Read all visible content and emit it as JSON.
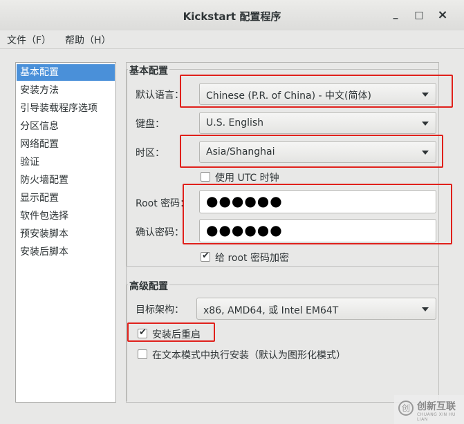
{
  "window": {
    "title": "Kickstart 配置程序",
    "minimize": "_",
    "maximize": "□",
    "close": "×"
  },
  "menu": {
    "file": "文件（F）",
    "help": "帮助（H）"
  },
  "sidebar": {
    "items": [
      {
        "label": "基本配置"
      },
      {
        "label": "安装方法"
      },
      {
        "label": "引导装载程序选项"
      },
      {
        "label": "分区信息"
      },
      {
        "label": "网络配置"
      },
      {
        "label": "验证"
      },
      {
        "label": "防火墙配置"
      },
      {
        "label": "显示配置"
      },
      {
        "label": "软件包选择"
      },
      {
        "label": "预安装脚本"
      },
      {
        "label": "安装后脚本"
      }
    ],
    "selected": "基本配置"
  },
  "basic": {
    "heading": "基本配置",
    "language_label": "默认语言：",
    "language_value": "Chinese (P.R. of China) - 中文(简体)",
    "keyboard_label": "键盘：",
    "keyboard_value": "U.S. English",
    "timezone_label": "时区：",
    "timezone_value": "Asia/Shanghai",
    "utc_label": "使用  UTC 时钟",
    "utc_checked": false,
    "root_pw_label": "Root 密码：",
    "root_pw_value": "●●●●●●",
    "confirm_pw_label": "确认密码：",
    "confirm_pw_value": "●●●●●●",
    "encrypt_label": "给  root 密码加密",
    "encrypt_checked": true
  },
  "advanced": {
    "heading": "高级配置",
    "arch_label": "目标架构：",
    "arch_value": "x86, AMD64, 或  Intel EM64T",
    "reboot_label": "安装后重启",
    "reboot_checked": true,
    "textmode_label": "在文本模式中执行安装（默认为图形化模式）",
    "textmode_checked": false
  },
  "watermark": {
    "logo": "创",
    "text": "创新互联",
    "sub": "CHUANG XIN HU LIAN"
  },
  "colors": {
    "selection": "#4a90d9",
    "highlight": "#e0201b"
  }
}
